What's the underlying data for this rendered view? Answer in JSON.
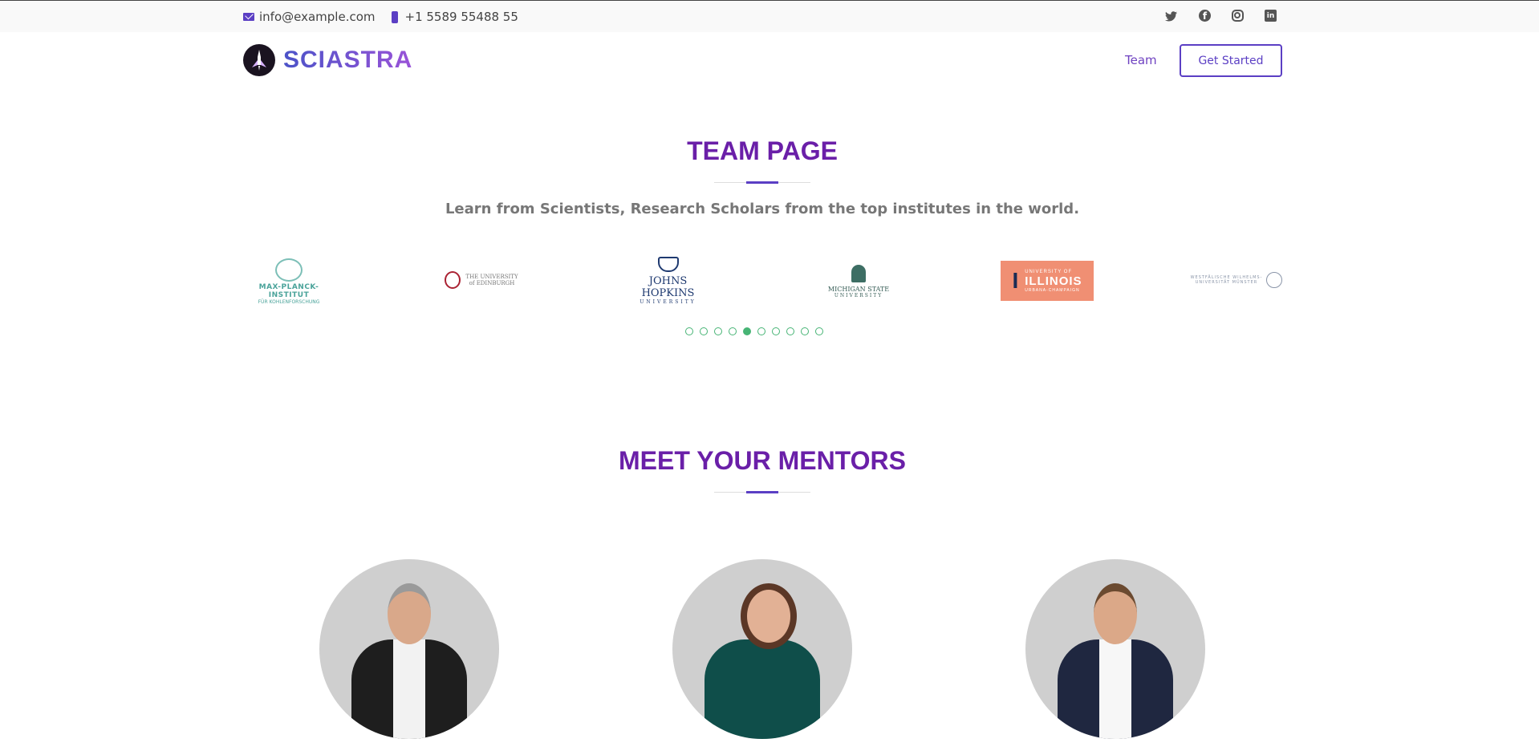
{
  "topbar": {
    "email": "info@example.com",
    "phone": "+1 5589 55488 55",
    "social": [
      "twitter-icon",
      "facebook-icon",
      "instagram-icon",
      "linkedin-icon"
    ]
  },
  "header": {
    "brand": "SCIASTRA",
    "nav_team": "Team",
    "cta": "Get Started"
  },
  "team_section": {
    "title": "TEAM PAGE",
    "subtitle": "Learn from Scientists, Research Scholars from the top institutes in the world."
  },
  "institutes": {
    "mpi": {
      "line1": "MAX-PLANCK-INSTITUT",
      "line2": "FÜR KOHLENFORSCHUNG"
    },
    "edinburgh": {
      "line1": "THE UNIVERSITY",
      "line2": "of EDINBURGH"
    },
    "jhu": {
      "line1": "JOHNS HOPKINS",
      "line2": "UNIVERSITY"
    },
    "msu": {
      "line1": "MICHIGAN STATE",
      "line2": "UNIVERSITY"
    },
    "illinois": {
      "line1": "UNIVERSITY OF",
      "line2": "ILLINOIS",
      "line3": "URBANA-CHAMPAIGN"
    },
    "wwu": {
      "line1": "WESTFÄLISCHE WILHELMS-UNIVERSITÄT MÜNSTER"
    }
  },
  "carousel": {
    "count": 10,
    "active_index": 4
  },
  "mentors_section": {
    "title": "MEET YOUR MENTORS"
  },
  "colors": {
    "accent": "#5b3fc4",
    "title": "#6a1fa8",
    "dot": "#47b475"
  }
}
